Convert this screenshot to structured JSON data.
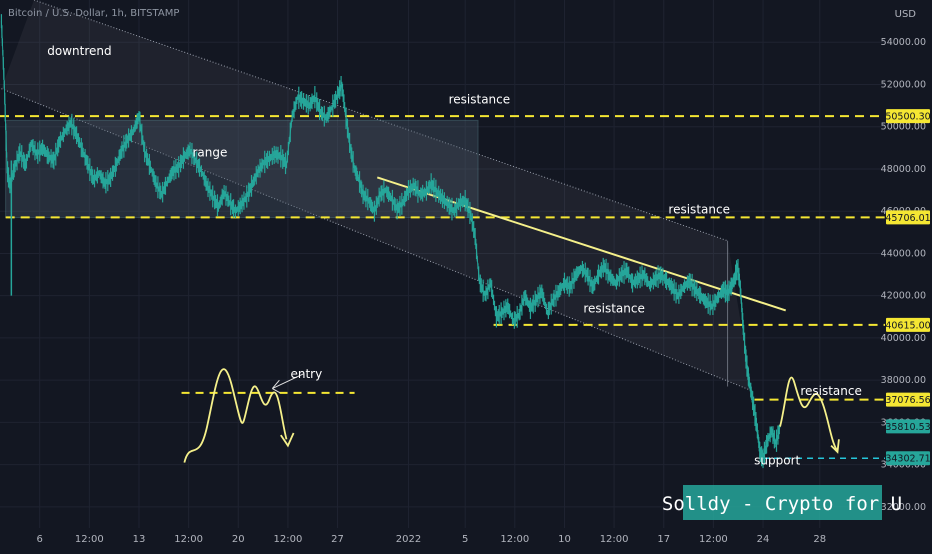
{
  "header": {
    "symbol_label": "Bitcoin / U.S. Dollar, 1h, BITSTAMP",
    "currency_label": "USD"
  },
  "chart_data": {
    "type": "line",
    "title": "Bitcoin / U.S. Dollar, 1h, BITSTAMP",
    "xlabel": "",
    "ylabel": "USD",
    "ylim": [
      31000,
      56000
    ],
    "y_ticks": [
      32000,
      34000,
      36000,
      38000,
      40000,
      42000,
      44000,
      46000,
      48000,
      50000,
      52000,
      54000
    ],
    "y_tick_labels": [
      "32000.00",
      "34000.00",
      "36000.00",
      "38000.00",
      "40000.00",
      "42000.00",
      "44000.00",
      "46000.00",
      "48000.00",
      "50000.00",
      "52000.00",
      "54000.00"
    ],
    "x_ticks": [
      "6",
      "12:00",
      "13",
      "12:00",
      "20",
      "12:00",
      "27",
      "2022",
      "5",
      "12:00",
      "10",
      "12:00",
      "17",
      "12:00",
      "24",
      "28"
    ],
    "x_domain_days": [
      3.2,
      30.3
    ],
    "x_tick_days": [
      6,
      9.5,
      13,
      16.5,
      20,
      23.5,
      27,
      32,
      36,
      39.5,
      43,
      46.5,
      50,
      53.5,
      57,
      61
    ],
    "grid": true,
    "series": [
      {
        "color": "#26a69a",
        "points": [
          [
            3.3,
            55000
          ],
          [
            3.5,
            52000
          ],
          [
            3.7,
            48000
          ],
          [
            3.9,
            47200
          ],
          [
            4.2,
            48000
          ],
          [
            4.6,
            48800
          ],
          [
            5.0,
            48200
          ],
          [
            5.4,
            49200
          ],
          [
            5.8,
            48700
          ],
          [
            6.2,
            49000
          ],
          [
            6.6,
            48600
          ],
          [
            7.0,
            48400
          ],
          [
            7.4,
            49300
          ],
          [
            7.8,
            49800
          ],
          [
            8.2,
            50200
          ],
          [
            8.6,
            49600
          ],
          [
            9.0,
            48900
          ],
          [
            9.4,
            48200
          ],
          [
            9.8,
            47500
          ],
          [
            10.2,
            47800
          ],
          [
            10.6,
            47300
          ],
          [
            11.0,
            47600
          ],
          [
            11.4,
            48200
          ],
          [
            11.8,
            48900
          ],
          [
            12.2,
            49400
          ],
          [
            12.6,
            49800
          ],
          [
            13.0,
            50500
          ],
          [
            13.4,
            48800
          ],
          [
            13.8,
            48100
          ],
          [
            14.2,
            47300
          ],
          [
            14.6,
            46800
          ],
          [
            15.0,
            47400
          ],
          [
            15.4,
            47900
          ],
          [
            15.8,
            48100
          ],
          [
            16.2,
            48600
          ],
          [
            16.6,
            48900
          ],
          [
            17.0,
            48400
          ],
          [
            17.4,
            47900
          ],
          [
            17.8,
            47200
          ],
          [
            18.2,
            46700
          ],
          [
            18.6,
            46200
          ],
          [
            19.0,
            46900
          ],
          [
            19.4,
            46400
          ],
          [
            19.8,
            46000
          ],
          [
            20.2,
            46300
          ],
          [
            20.6,
            46700
          ],
          [
            21.0,
            47300
          ],
          [
            21.4,
            47900
          ],
          [
            21.8,
            48300
          ],
          [
            22.2,
            48500
          ],
          [
            22.6,
            48700
          ],
          [
            23.0,
            48600
          ],
          [
            23.4,
            48200
          ],
          [
            23.8,
            50500
          ],
          [
            24.2,
            51400
          ],
          [
            24.6,
            51200
          ],
          [
            25.0,
            51000
          ],
          [
            25.4,
            51400
          ],
          [
            25.8,
            50700
          ],
          [
            26.2,
            50400
          ],
          [
            26.6,
            50900
          ],
          [
            27.0,
            51500
          ],
          [
            27.3,
            52000
          ],
          [
            27.6,
            50400
          ],
          [
            27.9,
            49000
          ],
          [
            28.2,
            48000
          ],
          [
            28.5,
            47500
          ],
          [
            28.8,
            46800
          ],
          [
            29.2,
            46500
          ],
          [
            29.6,
            46000
          ],
          [
            30.0,
            46800
          ],
          [
            30.4,
            47000
          ],
          [
            30.8,
            46600
          ],
          [
            31.2,
            46100
          ],
          [
            31.6,
            46400
          ],
          [
            32.0,
            47000
          ],
          [
            32.4,
            47200
          ],
          [
            32.8,
            46800
          ],
          [
            33.2,
            46900
          ],
          [
            33.6,
            47300
          ],
          [
            34.0,
            46900
          ],
          [
            34.4,
            46600
          ],
          [
            34.8,
            46300
          ],
          [
            35.2,
            46000
          ],
          [
            35.6,
            46400
          ],
          [
            36.0,
            46500
          ],
          [
            36.4,
            45800
          ],
          [
            36.7,
            44800
          ],
          [
            37.0,
            42700
          ],
          [
            37.4,
            42000
          ],
          [
            37.8,
            42600
          ],
          [
            38.2,
            41000
          ],
          [
            38.6,
            41200
          ],
          [
            39.0,
            41500
          ],
          [
            39.4,
            40800
          ],
          [
            39.8,
            41100
          ],
          [
            40.2,
            42000
          ],
          [
            40.6,
            41400
          ],
          [
            41.0,
            41800
          ],
          [
            41.4,
            42200
          ],
          [
            41.8,
            41200
          ],
          [
            42.2,
            41800
          ],
          [
            42.6,
            42200
          ],
          [
            43.0,
            42600
          ],
          [
            43.4,
            42400
          ],
          [
            43.8,
            43000
          ],
          [
            44.2,
            43300
          ],
          [
            44.6,
            43000
          ],
          [
            45.0,
            42400
          ],
          [
            45.4,
            43000
          ],
          [
            45.8,
            43400
          ],
          [
            46.2,
            42900
          ],
          [
            46.6,
            42600
          ],
          [
            47.0,
            43000
          ],
          [
            47.4,
            43200
          ],
          [
            47.8,
            42600
          ],
          [
            48.2,
            42800
          ],
          [
            48.6,
            43000
          ],
          [
            49.0,
            42500
          ],
          [
            49.4,
            42800
          ],
          [
            49.8,
            43000
          ],
          [
            50.2,
            42700
          ],
          [
            50.6,
            42400
          ],
          [
            51.0,
            42000
          ],
          [
            51.4,
            42400
          ],
          [
            51.8,
            42700
          ],
          [
            52.2,
            42300
          ],
          [
            52.6,
            42000
          ],
          [
            53.0,
            41700
          ],
          [
            53.4,
            41500
          ],
          [
            53.8,
            41900
          ],
          [
            54.2,
            42300
          ],
          [
            54.5,
            42100
          ],
          [
            54.8,
            42500
          ],
          [
            55.0,
            42800
          ],
          [
            55.2,
            43400
          ],
          [
            55.4,
            42400
          ],
          [
            55.6,
            40500
          ],
          [
            55.8,
            39000
          ],
          [
            56.0,
            38000
          ],
          [
            56.2,
            37300
          ],
          [
            56.4,
            36500
          ],
          [
            56.6,
            35600
          ],
          [
            56.8,
            34500
          ],
          [
            57.0,
            34300
          ],
          [
            57.3,
            35100
          ],
          [
            57.6,
            35600
          ],
          [
            57.9,
            35000
          ],
          [
            58.2,
            35800
          ]
        ]
      }
    ],
    "price_labels": [
      {
        "value": 50500.3,
        "text": "50500.30",
        "color": "#f5e733"
      },
      {
        "value": 45706.01,
        "text": "45706.01",
        "color": "#f5e733"
      },
      {
        "value": 40615.0,
        "text": "40615.00",
        "color": "#f5e733"
      },
      {
        "value": 37076.56,
        "text": "37076.56",
        "color": "#f5e733"
      },
      {
        "value": 35810.53,
        "text": "35810.53",
        "color": "#26a69a"
      },
      {
        "value": 34302.71,
        "text": "34302.71",
        "color": "#26a69a"
      }
    ],
    "annotations": [
      {
        "text": "downtrend",
        "day": 8.8,
        "value": 53400
      },
      {
        "text": "range",
        "day": 18.0,
        "value": 48600
      },
      {
        "text": "resistance",
        "day": 37.0,
        "value": 51100
      },
      {
        "text": "resistance",
        "day": 52.5,
        "value": 45900
      },
      {
        "text": "resistance",
        "day": 46.5,
        "value": 41200
      },
      {
        "text": "resistance",
        "day": 61.8,
        "value": 37300
      },
      {
        "text": "entry",
        "day": 24.8,
        "value": 38100
      },
      {
        "text": "support",
        "day": 58.0,
        "value": 34000
      }
    ],
    "watermark": "Solldy - Crypto for U"
  },
  "colors": {
    "background": "#131722",
    "grid": "#1f2331",
    "candle": "#26a69a",
    "level_line": "#f5e733",
    "support_line": "#26c6da",
    "watermark_bg": "#26a69a",
    "box_fill": "#2a2e39",
    "axis_text": "#b2b5be"
  }
}
